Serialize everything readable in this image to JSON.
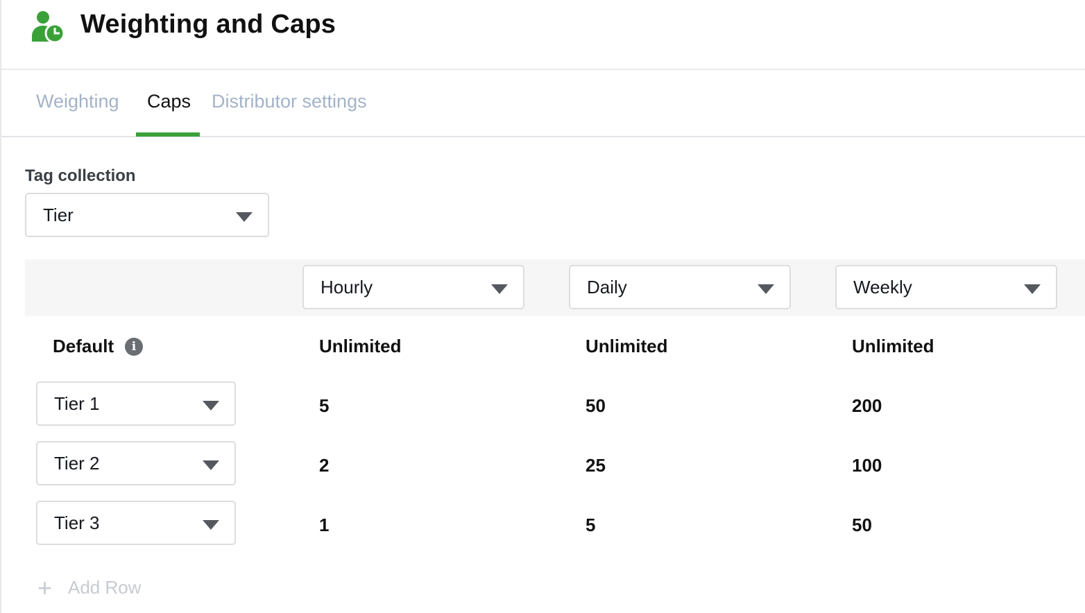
{
  "header": {
    "title": "Weighting and Caps",
    "logo_icon": "person-clock-icon",
    "brand_color": "#3aa138"
  },
  "tabs": [
    {
      "label": "Weighting",
      "active": false
    },
    {
      "label": "Caps",
      "active": true
    },
    {
      "label": "Distributor settings",
      "active": false
    }
  ],
  "tag_collection": {
    "label": "Tag collection",
    "value": "Tier"
  },
  "columns": [
    {
      "value": "Hourly"
    },
    {
      "value": "Daily"
    },
    {
      "value": "Weekly"
    }
  ],
  "default_row": {
    "label": "Default",
    "info_icon": "info-icon",
    "values": [
      "Unlimited",
      "Unlimited",
      "Unlimited"
    ]
  },
  "rows": [
    {
      "tier": "Tier 1",
      "values": [
        "5",
        "50",
        "200"
      ]
    },
    {
      "tier": "Tier 2",
      "values": [
        "2",
        "25",
        "100"
      ]
    },
    {
      "tier": "Tier 3",
      "values": [
        "1",
        "5",
        "50"
      ]
    }
  ],
  "add_row": {
    "label": "Add Row",
    "icon": "plus-icon"
  }
}
